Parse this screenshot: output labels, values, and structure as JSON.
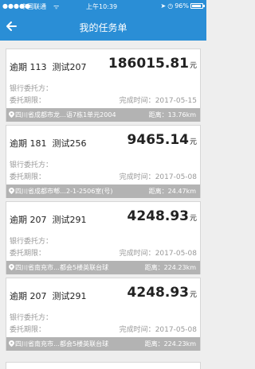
{
  "status": {
    "signal": "●●●●●",
    "carrier": "中国联通",
    "wifi": "ᯤ",
    "time": "上午10:39",
    "battery": "96%"
  },
  "header": {
    "title": "我的任务单",
    "back_icon": "back-arrow-icon"
  },
  "labels": {
    "bank": "银行委托方：",
    "term": "委托期限：",
    "done_prefix": "完成时间：",
    "dist_prefix": "距离：",
    "unit": "元"
  },
  "tasks": [
    {
      "tag": "逾期",
      "num": "113",
      "name": "测试207",
      "amount": "186015.81",
      "done": "2017-05-15",
      "address": "四川省成都市龙…语7栋1单元2004",
      "distance": "13.76km"
    },
    {
      "tag": "逾期",
      "num": "181",
      "name": "测试256",
      "amount": "9465.14",
      "done": "2017-05-08",
      "address": "四川省成都市郫…2-1-2506室(号)",
      "distance": "24.47km"
    },
    {
      "tag": "逾期",
      "num": "207",
      "name": "测试291",
      "amount": "4248.93",
      "done": "2017-05-08",
      "address": "四川省南充市…都会5楼英联台球",
      "distance": "224.23km"
    },
    {
      "tag": "逾期",
      "num": "207",
      "name": "测试291",
      "amount": "4248.93",
      "done": "2017-05-08",
      "address": "四川省南充市…都会5楼英联台球",
      "distance": "224.23km"
    }
  ],
  "colors": {
    "primary": "#2a8ed6",
    "address_bar": "#b3b3b3"
  }
}
